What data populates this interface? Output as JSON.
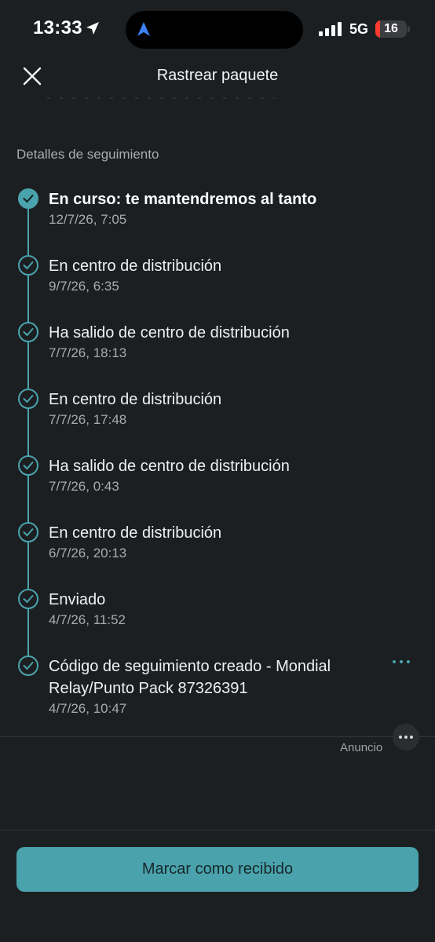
{
  "status_bar": {
    "time": "13:33",
    "network": "5G",
    "battery": "16",
    "battery_level": 0.16
  },
  "header": {
    "title": "Rastrear paquete",
    "close_icon": "close-icon"
  },
  "tracking": {
    "section_label": "Detalles de seguimiento",
    "events": [
      {
        "title": "En curso: te mantendremos al tanto",
        "date": "12/7/26, 7:05",
        "current": true
      },
      {
        "title": "En centro de distribución",
        "date": "9/7/26, 6:35"
      },
      {
        "title": "Ha salido de centro de distribución",
        "date": "7/7/26, 18:13"
      },
      {
        "title": "En centro de distribución",
        "date": "7/7/26, 17:48"
      },
      {
        "title": "Ha salido de centro de distribución",
        "date": "7/7/26, 0:43"
      },
      {
        "title": "En centro de distribución",
        "date": "6/7/26, 20:13"
      },
      {
        "title": "Enviado",
        "date": "4/7/26, 11:52"
      },
      {
        "title": "Código de seguimiento creado - Mondial Relay/Punto Pack  87326391",
        "date": "4/7/26, 10:47"
      }
    ]
  },
  "ad": {
    "label": "Anuncio"
  },
  "actions": {
    "mark_received": "Marcar como recibido"
  },
  "colors": {
    "accent": "#4aa3ac",
    "background": "#1c1f21",
    "battery_low": "#ff3b30"
  }
}
